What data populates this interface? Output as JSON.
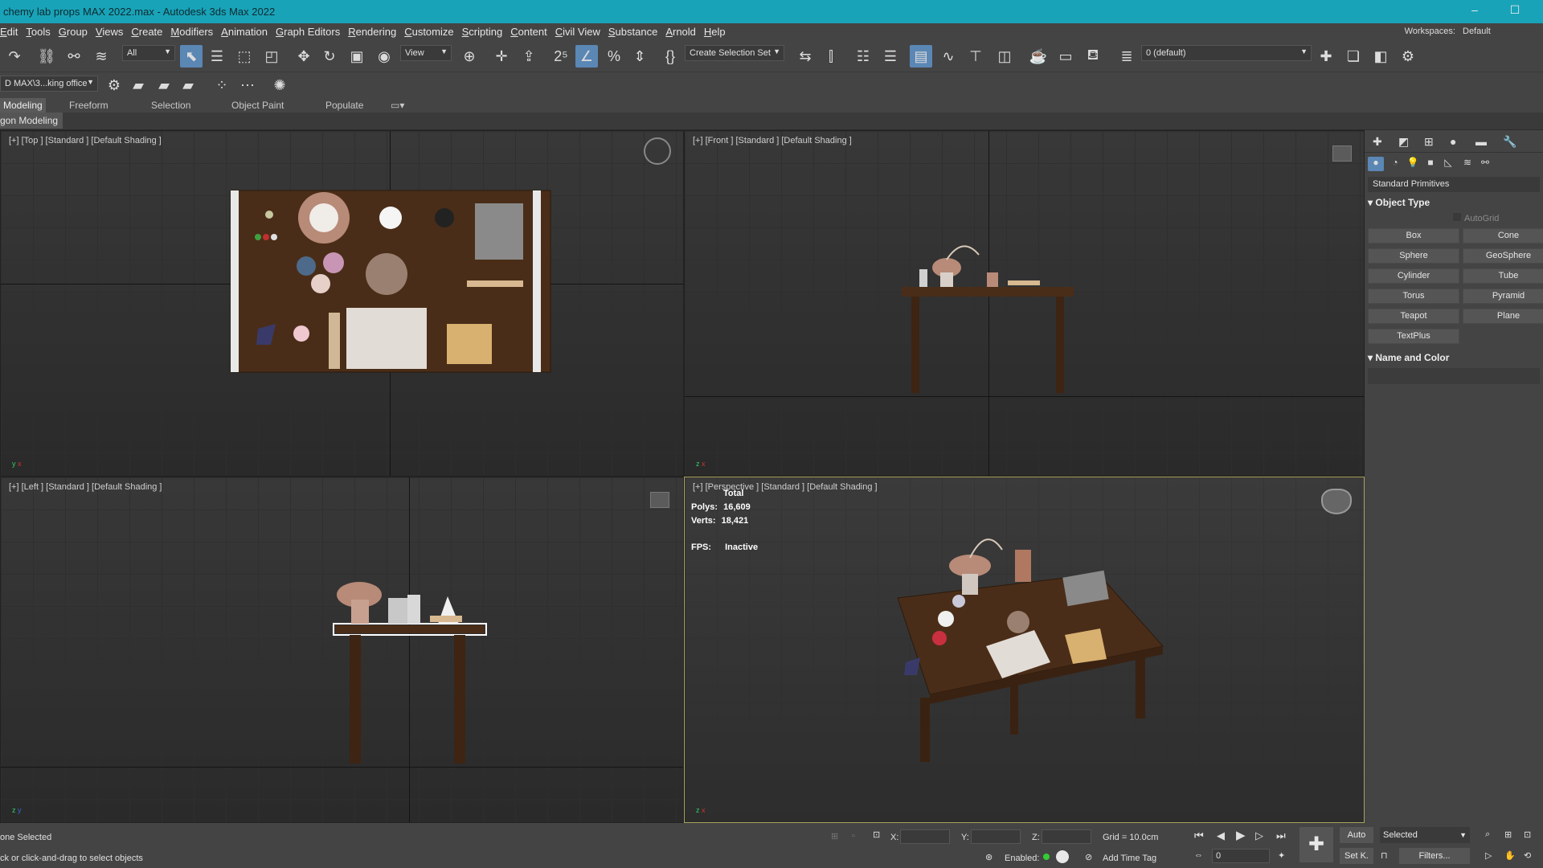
{
  "window": {
    "title": "chemy lab props MAX 2022.max - Autodesk 3ds Max 2022",
    "minimize": "–",
    "maximize": "☐"
  },
  "menu": {
    "items": [
      "Edit",
      "Tools",
      "Group",
      "Views",
      "Create",
      "Modifiers",
      "Animation",
      "Graph Editors",
      "Rendering",
      "Customize",
      "Scripting",
      "Content",
      "Civil View",
      "Substance",
      "Arnold",
      "Help"
    ],
    "workspaces_label": "Workspaces:",
    "workspaces_value": "Default"
  },
  "toolbar": {
    "filter_value": "All",
    "refcoord_value": "View",
    "selection_set": "Create Selection Set",
    "layer_value": "0 (default)",
    "project_value": "D MAX\\3...king office"
  },
  "ribbon": {
    "tabs": [
      "Modeling",
      "Freeform",
      "Selection",
      "Object Paint",
      "Populate"
    ],
    "active_tab": "Modeling",
    "sub": "gon Modeling"
  },
  "viewports": {
    "top": "[+] [Top ] [Standard ] [Default Shading ]",
    "front": "[+] [Front ] [Standard ] [Default Shading ]",
    "left": "[+] [Left ] [Standard ] [Default Shading ]",
    "perspective": "[+] [Perspective ] [Standard ] [Default Shading ]"
  },
  "stats": {
    "total_label": "Total",
    "polys_label": "Polys:",
    "polys_value": "16,609",
    "verts_label": "Verts:",
    "verts_value": "18,421",
    "fps_label": "FPS:",
    "fps_value": "Inactive"
  },
  "command_panel": {
    "category": "Standard Primitives",
    "object_type": "Object Type",
    "autogrid": "AutoGrid",
    "primitives": [
      "Box",
      "Cone",
      "Sphere",
      "GeoSphere",
      "Cylinder",
      "Tube",
      "Torus",
      "Pyramid",
      "Teapot",
      "Plane",
      "TextPlus"
    ],
    "name_and_color": "Name and Color"
  },
  "status": {
    "selection": "one Selected",
    "prompt": "ck or click-and-drag to select objects",
    "x_label": "X:",
    "y_label": "Y:",
    "z_label": "Z:",
    "grid": "Grid = 10.0cm",
    "enabled_label": "Enabled:",
    "add_time_tag": "Add Time Tag",
    "auto": "Auto",
    "setk": "Set K.",
    "selected_value": "Selected",
    "filters": "Filters...",
    "frame": "0"
  },
  "colors": {
    "titlebar": "#19a3b8",
    "active_tool": "#5b87b5",
    "viewport_bg": "#333333",
    "active_viewport_border": "#a8a25a"
  }
}
